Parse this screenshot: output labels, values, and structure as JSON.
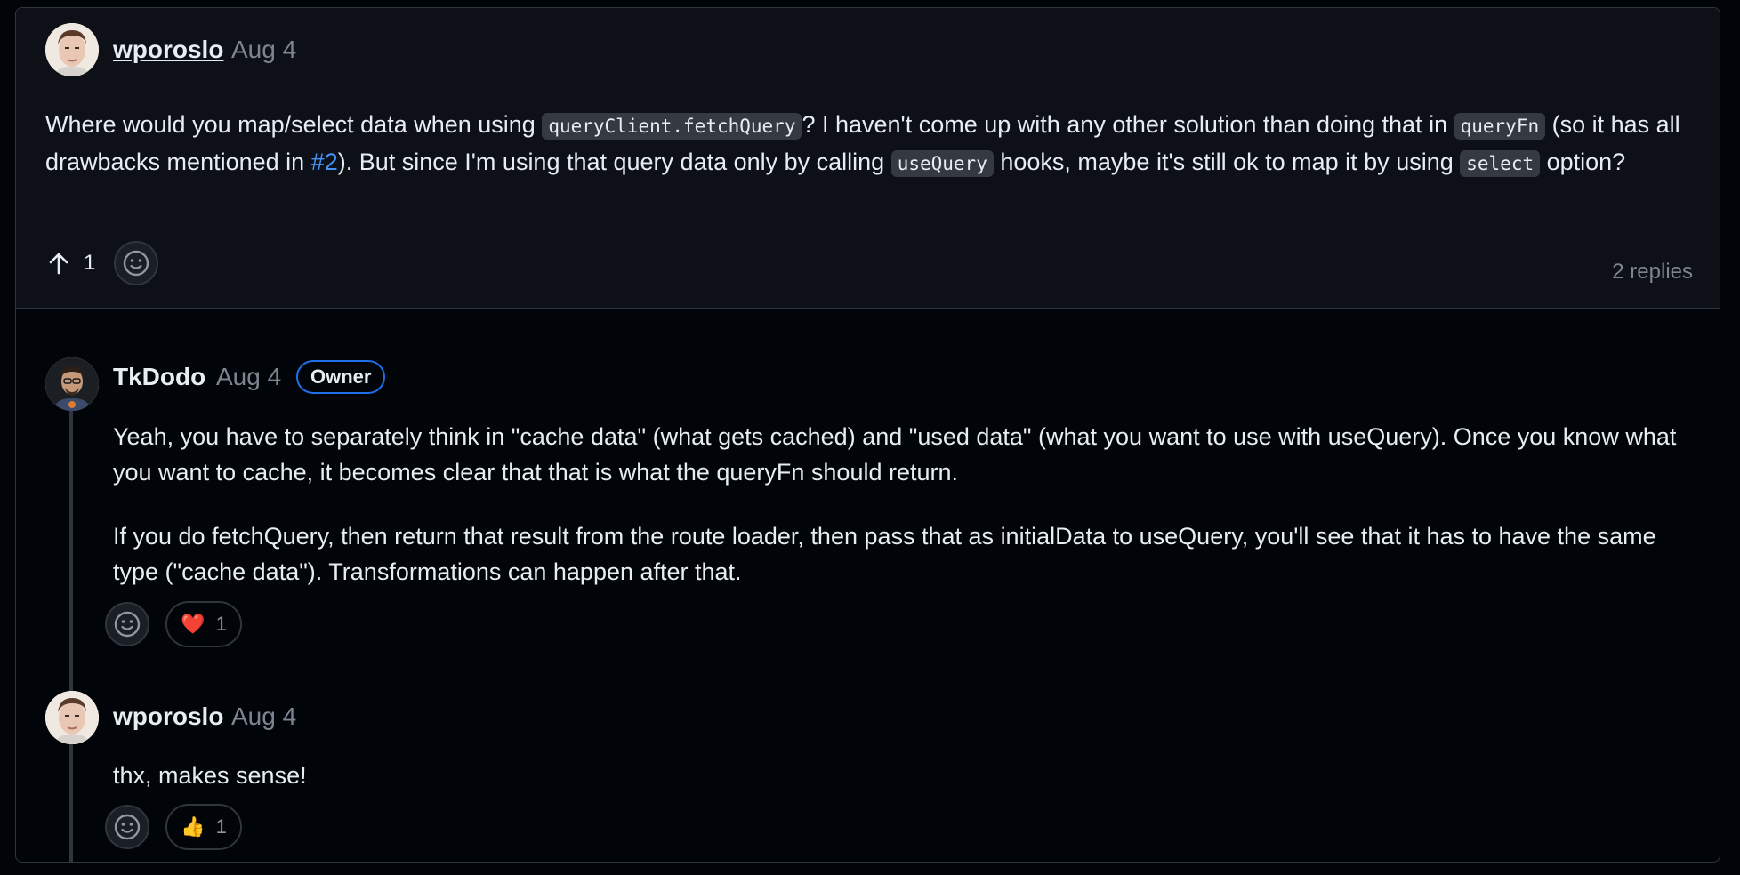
{
  "post": {
    "author": "wporoslo",
    "date": "Aug 4",
    "body": {
      "t1": "Where would you map/select data when using ",
      "c1": "queryClient.fetchQuery",
      "t2": "? I haven't come up with any other solution than doing that in ",
      "c2": "queryFn",
      "t3": " (so it has all drawbacks mentioned in ",
      "link": "#2",
      "t4": "). But since I'm using that query data only by calling ",
      "c3": "useQuery",
      "t5": " hooks, maybe it's still ok to map it by using ",
      "c4": "select",
      "t6": " option?"
    },
    "upvote_count": "1",
    "replies_count": "2 replies"
  },
  "replies": [
    {
      "author": "TkDodo",
      "date": "Aug 4",
      "badge": "Owner",
      "paragraphs": [
        "Yeah, you have to separately think in \"cache data\" (what gets cached) and \"used data\" (what you want to use with useQuery). Once you know what you want to cache, it becomes clear that that is what the queryFn should return.",
        "If you do fetchQuery, then return that result from the route loader, then pass that as initialData to useQuery, you'll see that it has to have the same type (\"cache data\"). Transformations can happen after that."
      ],
      "reaction": {
        "emoji": "❤️",
        "icon": "heart-icon",
        "count": "1"
      }
    },
    {
      "author": "wporoslo",
      "date": "Aug 4",
      "paragraphs": [
        "thx, makes sense!"
      ],
      "reaction": {
        "emoji": "👍",
        "icon": "thumbs-up-icon",
        "count": "1"
      }
    }
  ],
  "colors": {
    "background": "#010409",
    "card": "#0d1117",
    "border": "#30363d",
    "link": "#4493f8",
    "muted": "#7d8590",
    "owner_badge_border": "#1f6feb"
  }
}
